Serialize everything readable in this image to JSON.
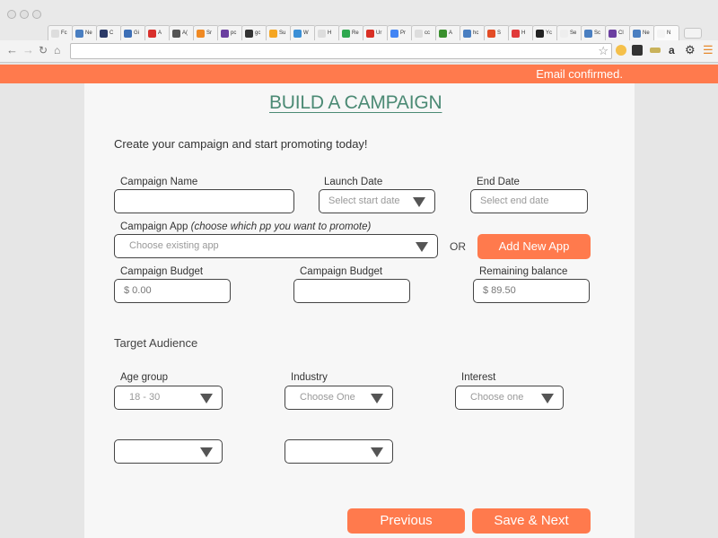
{
  "browser": {
    "tabs": [
      {
        "label": "Fc",
        "icon": "document-icon",
        "color": "#dddddd"
      },
      {
        "label": "Ne",
        "icon": "chevrons-icon",
        "color": "#4a7fc1"
      },
      {
        "label": "C",
        "icon": "f-logo-icon",
        "color": "#2b3a67"
      },
      {
        "label": "Gi",
        "icon": "gc-logo-icon",
        "color": "#3d6fb6"
      },
      {
        "label": "A",
        "icon": "a-logo-icon",
        "color": "#d9302c"
      },
      {
        "label": "A(",
        "icon": "gear-logo-icon",
        "color": "#555555"
      },
      {
        "label": "Sr",
        "icon": "e-logo-icon",
        "color": "#f08a24"
      },
      {
        "label": "pc",
        "icon": "peace-logo-icon",
        "color": "#6b3fa0"
      },
      {
        "label": "gc",
        "icon": "grid-logo-icon",
        "color": "#333333"
      },
      {
        "label": "Su",
        "icon": "bolt-logo-icon",
        "color": "#f5a623"
      },
      {
        "label": "W",
        "icon": "wing-logo-icon",
        "color": "#3b8fd6"
      },
      {
        "label": "H",
        "icon": "document-icon",
        "color": "#dddddd"
      },
      {
        "label": "Re",
        "icon": "drive-logo-icon",
        "color": "#2fa84f"
      },
      {
        "label": "Ur",
        "icon": "red-logo-icon",
        "color": "#d93025"
      },
      {
        "label": "Pr",
        "icon": "blue-doc-icon",
        "color": "#4285f4"
      },
      {
        "label": "cc",
        "icon": "document-icon",
        "color": "#dddddd"
      },
      {
        "label": "A",
        "icon": "green-logo-icon",
        "color": "#3a8f2d"
      },
      {
        "label": "hc",
        "icon": "g-logo-icon",
        "color": "#4a7fc1"
      },
      {
        "label": "S",
        "icon": "dash-logo-icon",
        "color": "#e34c26"
      },
      {
        "label": "H",
        "icon": "bars-logo-icon",
        "color": "#e03a3a"
      },
      {
        "label": "Yc",
        "icon": "yc-logo-icon",
        "color": "#222222"
      },
      {
        "label": "Se",
        "icon": "blank-icon",
        "color": "#eeeeee"
      },
      {
        "label": "Sc",
        "icon": "g-logo-icon",
        "color": "#4a7fc1"
      },
      {
        "label": "Cl",
        "icon": "mail-logo-icon",
        "color": "#6b3fa0"
      },
      {
        "label": "Ne",
        "icon": "chevrons-icon",
        "color": "#4a7fc1"
      },
      {
        "label": "N",
        "icon": "blank-icon",
        "color": "#f4f4f4"
      }
    ],
    "address": ""
  },
  "notice": {
    "text": "Email confirmed."
  },
  "form": {
    "title": "BUILD A CAMPAIGN",
    "intro": "Create your campaign and start promoting today!",
    "campaign_name": {
      "label": "Campaign Name",
      "value": ""
    },
    "launch_date": {
      "label": "Launch Date",
      "placeholder": "Select start date"
    },
    "end_date": {
      "label": "End Date",
      "placeholder": "Select end date"
    },
    "campaign_app": {
      "label": "Campaign App ",
      "label_hint": "(choose which pp you want to promote)",
      "placeholder": "Choose existing app"
    },
    "or_text": "OR",
    "add_app_label": "Add New App",
    "budget1": {
      "label": "Campaign Budget",
      "value": "$ 0.00"
    },
    "budget2": {
      "label": "Campaign Budget",
      "value": ""
    },
    "remaining": {
      "label": "Remaining balance",
      "value": "$ 89.50"
    },
    "target_heading": "Target Audience",
    "age_group": {
      "label": "Age group",
      "value": "18 - 30"
    },
    "industry": {
      "label": "Industry",
      "placeholder": "Choose One"
    },
    "interest": {
      "label": "Interest",
      "placeholder": "Choose one"
    },
    "extra1": {
      "value": ""
    },
    "extra2": {
      "value": ""
    },
    "previous_label": "Previous",
    "next_label": "Save & Next"
  },
  "colors": {
    "accent": "#ff7a4d",
    "title": "#4b8a74"
  }
}
